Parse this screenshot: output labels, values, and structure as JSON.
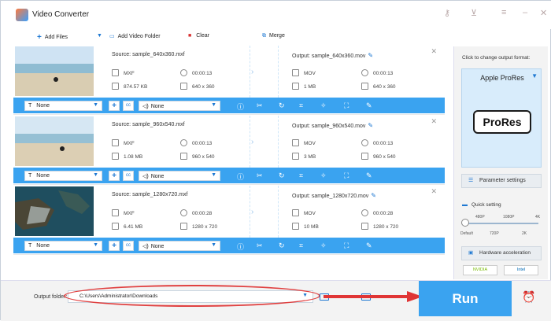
{
  "app": {
    "title": "Video Converter"
  },
  "toolbar": {
    "add_files": "Add Files",
    "add_folder": "Add Video Folder",
    "clear": "Clear",
    "merge": "Merge"
  },
  "rows": [
    {
      "source": "Source: sample_640x360.mxf",
      "output": "Output: sample_640x360.mov",
      "src_format": "MXF",
      "src_duration": "00:00:13",
      "src_size": "874.57 KB",
      "src_res": "640 x 360",
      "out_format": "MOV",
      "out_duration": "00:00:13",
      "out_size": "1 MB",
      "out_res": "640 x 360",
      "subtitle": "None",
      "audio": "None"
    },
    {
      "source": "Source: sample_960x540.mxf",
      "output": "Output: sample_960x540.mov",
      "src_format": "MXF",
      "src_duration": "00:00:13",
      "src_size": "1.08 MB",
      "src_res": "960 x 540",
      "out_format": "MOV",
      "out_duration": "00:00:13",
      "out_size": "3 MB",
      "out_res": "960 x 540",
      "subtitle": "None",
      "audio": "None"
    },
    {
      "source": "Source: sample_1280x720.mxf",
      "output": "Output: sample_1280x720.mov",
      "src_format": "MXF",
      "src_duration": "00:00:28",
      "src_size": "6.41 MB",
      "src_res": "1280 x 720",
      "out_format": "MOV",
      "out_duration": "00:00:28",
      "out_size": "10 MB",
      "out_res": "1280 x 720",
      "subtitle": "None",
      "audio": "None"
    }
  ],
  "side": {
    "hint": "Click to change output format:",
    "format_name": "Apple ProRes",
    "format_badge": "ProRes",
    "param_settings": "Parameter settings",
    "quick_setting": "Quick setting",
    "ticks_top": [
      "480P",
      "1080P",
      "4K"
    ],
    "ticks_bottom": [
      "Default",
      "720P",
      "2K"
    ],
    "hw_accel": "Hardware acceleration",
    "nvidia": "NVIDIA",
    "intel": "Intel"
  },
  "bottom": {
    "output_folder_label": "Output folder:",
    "output_folder": "C:\\Users\\Administrator\\Downloads",
    "run": "Run"
  },
  "colors": {
    "accent": "#3aa3f0",
    "highlight": "#e03535"
  }
}
